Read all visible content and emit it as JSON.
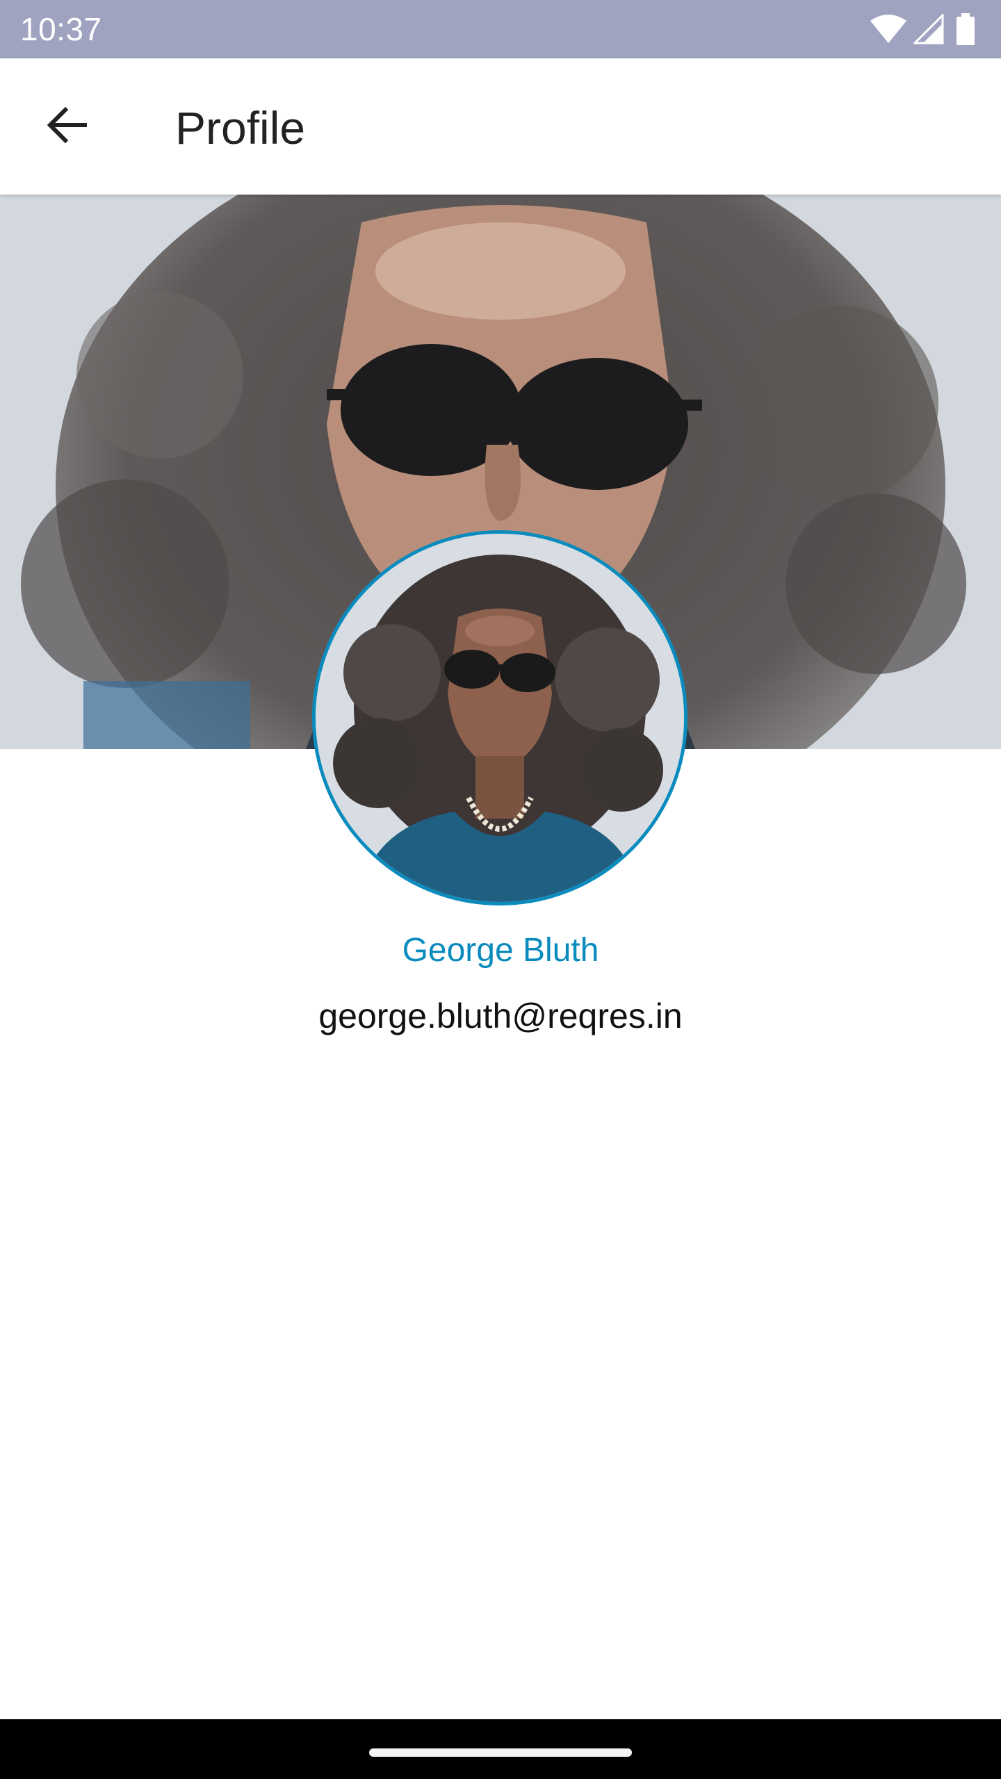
{
  "status_bar": {
    "time": "10:37",
    "icons": [
      "wifi-icon",
      "cell-signal-icon",
      "battery-icon"
    ]
  },
  "app_bar": {
    "back_icon": "arrow-back-icon",
    "title": "Profile"
  },
  "profile": {
    "name": "George Bluth",
    "email": "george.bluth@reqres.in"
  },
  "colors": {
    "status_bar": "#a0a3c0",
    "accent": "#0a8bbd",
    "text": "#111111",
    "nav_bar": "#000000"
  }
}
